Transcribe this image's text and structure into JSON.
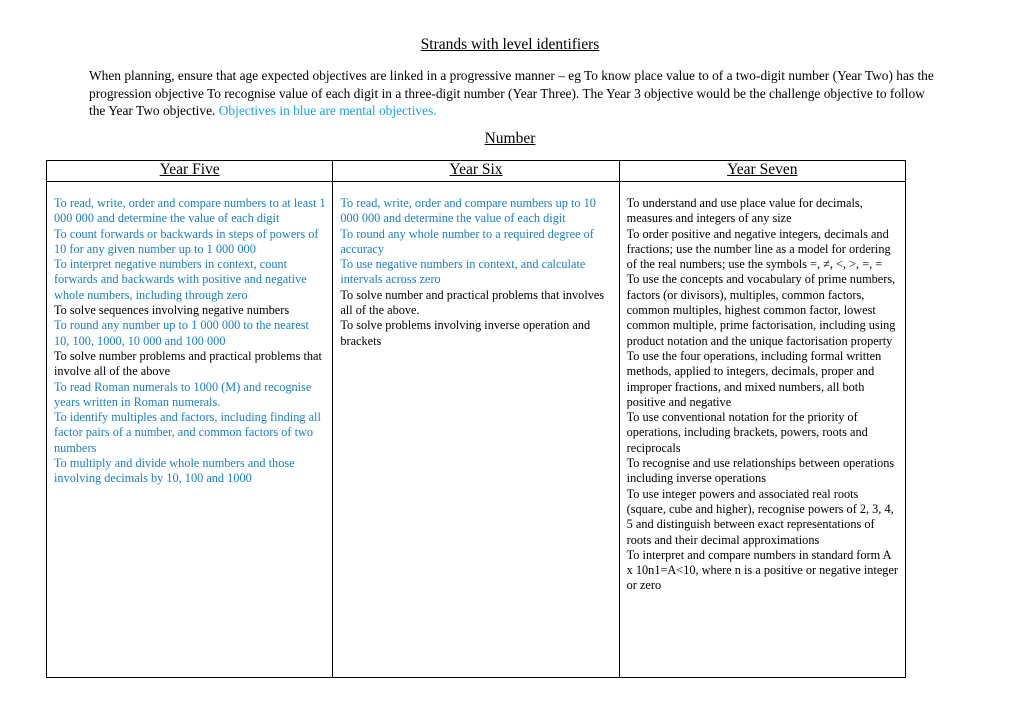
{
  "document": {
    "title": "Strands with level identifiers",
    "intro": {
      "text": "When planning, ensure that age expected objectives are linked in a progressive manner – eg To know place value to of a two-digit number (Year Two) has the progression objective To recognise value of each digit in a three-digit number (Year Three). The Year 3 objective would be the challenge objective to follow the Year Two objective. ",
      "highlight": "Objectives in blue are mental objectives."
    },
    "colors": {
      "mental_objective": "#1a7fc1",
      "intro_highlight": "#1aa3dd",
      "text": "#000000"
    },
    "section_title": "Number",
    "table": {
      "headers": [
        "Year Five",
        "Year Six",
        "Year Seven"
      ],
      "columns": [
        [
          {
            "text": "To read, write, order and compare numbers to at least 1 000 000 and determine the value of each digit",
            "mental": true
          },
          {
            "text": "To count forwards or backwards in steps of powers of 10 for any given number up to 1 000 000",
            "mental": true
          },
          {
            "text": "To interpret negative numbers in context, count forwards and backwards with positive and negative whole numbers, including through zero",
            "mental": true
          },
          {
            "text": "To solve sequences involving negative numbers",
            "mental": false
          },
          {
            "text": "To round any number up to 1 000 000 to the nearest 10, 100, 1000, 10 000 and 100 000",
            "mental": true
          },
          {
            "text": "To solve number problems and practical problems that involve all of the above",
            "mental": false
          },
          {
            "text": "To read Roman numerals to 1000 (M) and recognise years written in Roman numerals.",
            "mental": true
          },
          {
            "text": "To identify multiples and factors, including finding all factor pairs of a number, and common factors of two numbers",
            "mental": true
          },
          {
            "text": "To multiply and divide whole numbers and those involving decimals by 10, 100 and 1000",
            "mental": true
          }
        ],
        [
          {
            "text": "To read, write, order and compare numbers up to 10 000 000 and determine the value of each digit",
            "mental": true
          },
          {
            "text": "To round any whole number to a required degree of accuracy",
            "mental": true
          },
          {
            "text": "To use negative numbers in context, and calculate intervals across zero",
            "mental": true
          },
          {
            "text": "To solve number and practical problems that involves all of the above.",
            "mental": false
          },
          {
            "text": "To solve problems involving inverse operation and brackets",
            "mental": false
          }
        ],
        [
          {
            "text": "To understand and use place value for decimals, measures and integers of any size",
            "mental": false
          },
          {
            "text": "To order positive and negative integers, decimals and fractions; use the number line as a model for ordering of the real numbers; use the symbols =, ≠, <, >, =, =",
            "mental": false
          },
          {
            "text": "To use the concepts and vocabulary of prime numbers, factors (or divisors), multiples, common factors, common multiples, highest common factor, lowest common multiple, prime factorisation, including using product notation and the unique factorisation property",
            "mental": false
          },
          {
            "text": "To use the four operations, including formal written methods, applied to integers, decimals, proper and improper fractions, and mixed numbers, all both positive and negative",
            "mental": false
          },
          {
            "text": "To use conventional notation for the priority of operations, including brackets, powers, roots and reciprocals",
            "mental": false
          },
          {
            "text": "To recognise and use relationships between operations including inverse operations",
            "mental": false
          },
          {
            "text": "To use integer powers and associated real roots (square, cube and higher), recognise powers of 2, 3, 4, 5  and distinguish between exact representations of roots and their decimal approximations",
            "mental": false
          },
          {
            "text": "To interpret and compare numbers in standard form A x 10n1=A<10, where n is a positive or negative integer or zero",
            "mental": false
          }
        ]
      ]
    }
  }
}
